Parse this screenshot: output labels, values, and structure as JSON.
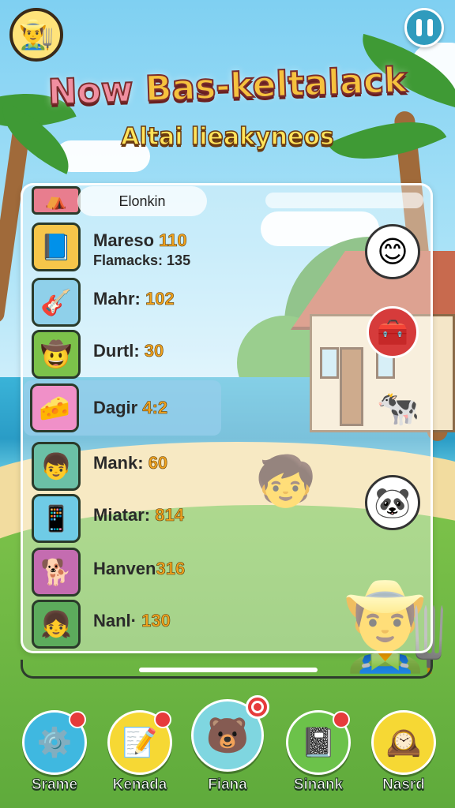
{
  "hud": {
    "player_avatar_icon": "farmer-avatar-icon",
    "pause_icon": "pause-icon"
  },
  "title": {
    "line1_word1": "Now",
    "line1_rest": "Bas-keltalack",
    "line2": "Altai lieakyneos"
  },
  "leaderboard": {
    "header": "Elonkin",
    "rows": [
      {
        "icon": "book-icon",
        "label": "Mareso ",
        "value": "110",
        "sub": "Flamacks: 135"
      },
      {
        "icon": "guitar-icon",
        "label": "Mahr: ",
        "value": "102",
        "sub": ""
      },
      {
        "icon": "cowboy-icon",
        "label": "Durtl: ",
        "value": "30",
        "sub": ""
      },
      {
        "icon": "cheese-icon",
        "label": "Dagir ",
        "value": "4:2",
        "sub": "",
        "highlighted": true
      },
      {
        "icon": "boy-icon",
        "label": "Mank: ",
        "value": "60",
        "sub": ""
      },
      {
        "icon": "phone-icon",
        "label": "Miatar: ",
        "value": "814",
        "sub": ""
      },
      {
        "icon": "dog-icon",
        "label": "Hanven",
        "value": "316",
        "sub": ""
      },
      {
        "icon": "girl-icon",
        "label": "Nanl· ",
        "value": "130",
        "sub": ""
      }
    ]
  },
  "side_icons": [
    "ghost-icon",
    "safe-icon",
    "cow-icon",
    "panda-icon"
  ],
  "nav": {
    "items": [
      {
        "label": "Srame",
        "icon": "gear-icon",
        "badge": true
      },
      {
        "label": "Kenada",
        "icon": "note-icon",
        "badge": true
      },
      {
        "label": "Fiana",
        "icon": "bear-icon",
        "badge": true
      },
      {
        "label": "Sinank",
        "icon": "notebook-icon",
        "badge": true
      },
      {
        "label": "Nasrd",
        "icon": "clock-icon",
        "badge": false
      }
    ]
  },
  "colors": {
    "title_fill": "#f6c23e",
    "value_text": "#f1a31e",
    "highlight_row": "#96cdeb",
    "badge": "#e63b3b"
  }
}
